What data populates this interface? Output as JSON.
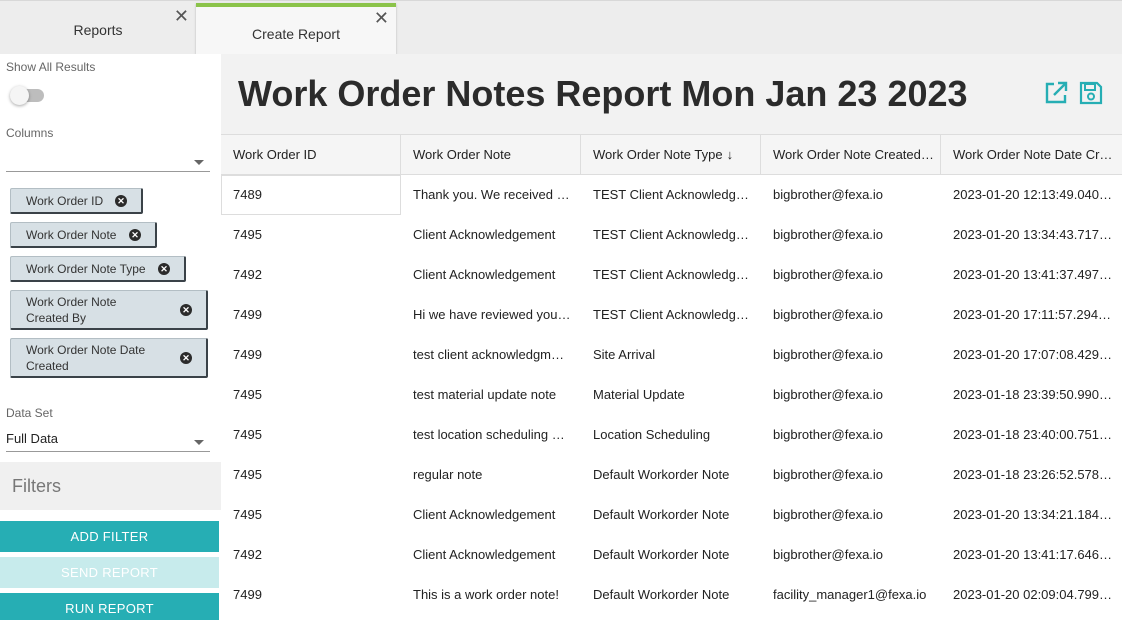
{
  "tabs": [
    {
      "label": "Reports",
      "close": "✕"
    },
    {
      "label": "Create Report",
      "close": "✕",
      "active_accent": "#8bc34a"
    }
  ],
  "sidebar": {
    "show_all_results_label": "Show All Results",
    "show_all_results_on": false,
    "columns_label": "Columns",
    "columns_value": "",
    "column_chips": [
      "Work Order ID",
      "Work Order Note",
      "Work Order Note Type",
      "Work Order Note Created By",
      "Work Order Note Date Created"
    ],
    "data_set_label": "Data Set",
    "data_set_value": "Full Data",
    "filters_label": "Filters",
    "buttons": {
      "add_filter": "ADD FILTER",
      "send_report": "SEND REPORT",
      "run_report": "RUN REPORT"
    }
  },
  "main": {
    "title": "Work Order Notes Report Mon Jan 23 2023",
    "icons": [
      "external-link-icon",
      "save-icon"
    ],
    "accent": "#26aeb4",
    "table": {
      "columns": [
        "Work Order ID",
        "Work Order Note",
        "Work Order Note Type",
        "Work Order Note Created…",
        "Work Order Note Date Cr…"
      ],
      "sort_column": 2,
      "sort_direction": "desc",
      "rows": [
        [
          "7489",
          "Thank you. We received y…",
          "TEST Client Acknowledg…",
          "bigbrother@fexa.io",
          "2023-01-20 12:13:49.040…"
        ],
        [
          "7495",
          "Client Acknowledgement",
          "TEST Client Acknowledg…",
          "bigbrother@fexa.io",
          "2023-01-20 13:34:43.717…"
        ],
        [
          "7492",
          "Client Acknowledgement",
          "TEST Client Acknowledg…",
          "bigbrother@fexa.io",
          "2023-01-20 13:41:37.497…"
        ],
        [
          "7499",
          "Hi we have reviewed your…",
          "TEST Client Acknowledg…",
          "bigbrother@fexa.io",
          "2023-01-20 17:11:57.294…"
        ],
        [
          "7499",
          "test client acknowledgm…",
          "Site Arrival",
          "bigbrother@fexa.io",
          "2023-01-20 17:07:08.429…"
        ],
        [
          "7495",
          "test material update note",
          "Material Update",
          "bigbrother@fexa.io",
          "2023-01-18 23:39:50.990…"
        ],
        [
          "7495",
          "test location scheduling …",
          "Location Scheduling",
          "bigbrother@fexa.io",
          "2023-01-18 23:40:00.751…"
        ],
        [
          "7495",
          "regular note",
          "Default Workorder Note",
          "bigbrother@fexa.io",
          "2023-01-18 23:26:52.578…"
        ],
        [
          "7495",
          "Client Acknowledgement",
          "Default Workorder Note",
          "bigbrother@fexa.io",
          "2023-01-20 13:34:21.184…"
        ],
        [
          "7492",
          "Client Acknowledgement",
          "Default Workorder Note",
          "bigbrother@fexa.io",
          "2023-01-20 13:41:17.646…"
        ],
        [
          "7499",
          "This is a work order note!",
          "Default Workorder Note",
          "facility_manager1@fexa.io",
          "2023-01-20 02:09:04.799…"
        ]
      ]
    }
  }
}
